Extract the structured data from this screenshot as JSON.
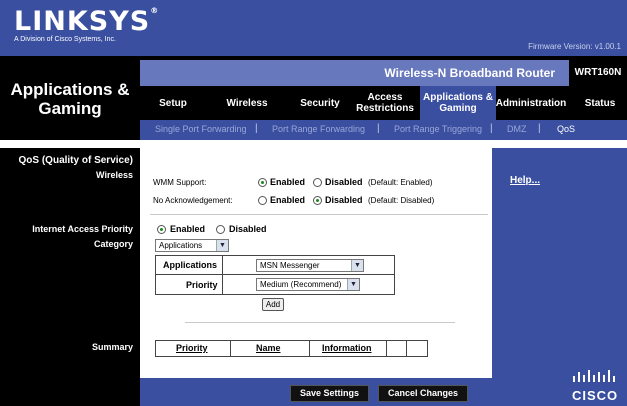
{
  "brand": {
    "logo": "LINKSYS",
    "registered_mark": "®",
    "tagline": "A Division of Cisco Systems, Inc.",
    "firmware": "Firmware Version: v1.00.1",
    "cisco": "CISCO"
  },
  "page": {
    "section_title": "Applications &\nGaming",
    "product_name": "Wireless-N Broadband Router",
    "model": "WRT160N"
  },
  "nav": {
    "tabs": [
      {
        "label": "Setup"
      },
      {
        "label": "Wireless"
      },
      {
        "label": "Security"
      },
      {
        "label": "Access\nRestrictions"
      },
      {
        "label": "Applications &\nGaming"
      },
      {
        "label": "Administration"
      },
      {
        "label": "Status"
      }
    ],
    "active_tab": "Applications &\nGaming",
    "sub": [
      {
        "label": "Single Port Forwarding"
      },
      {
        "label": "Port Range Forwarding"
      },
      {
        "label": "Port Range Triggering"
      },
      {
        "label": "DMZ"
      },
      {
        "label": "QoS"
      }
    ],
    "separator": "|",
    "active_sub": "QoS"
  },
  "left": {
    "title": "QoS (Quality of Service)",
    "wireless": "Wireless",
    "iap": "Internet Access Priority",
    "category": "Category",
    "summary": "Summary"
  },
  "wireless": {
    "wmm_label": "WMM Support:",
    "wmm_value": "Enabled",
    "wmm_default": "(Default: Enabled)",
    "noack_label": "No Acknowledgement:",
    "noack_value": "Disabled",
    "noack_default": "(Default: Disabled)",
    "enabled_label": "Enabled",
    "disabled_label": "Disabled"
  },
  "iap": {
    "value": "Enabled",
    "enabled_label": "Enabled",
    "disabled_label": "Disabled",
    "category_value": "Applications"
  },
  "rule": {
    "app_label": "Applications",
    "app_value": "MSN Messenger",
    "priority_label": "Priority",
    "priority_value": "Medium (Recommend)",
    "add_label": "Add"
  },
  "summary_table": {
    "columns": [
      "Priority",
      "Name",
      "Information"
    ]
  },
  "help": {
    "link": "Help..."
  },
  "buttons": {
    "save": "Save Settings",
    "cancel": "Cancel Changes"
  },
  "colors": {
    "brand_blue": "#3a4fa0",
    "light_blue": "#6878bd",
    "radio_green": "#1a8a1a"
  }
}
